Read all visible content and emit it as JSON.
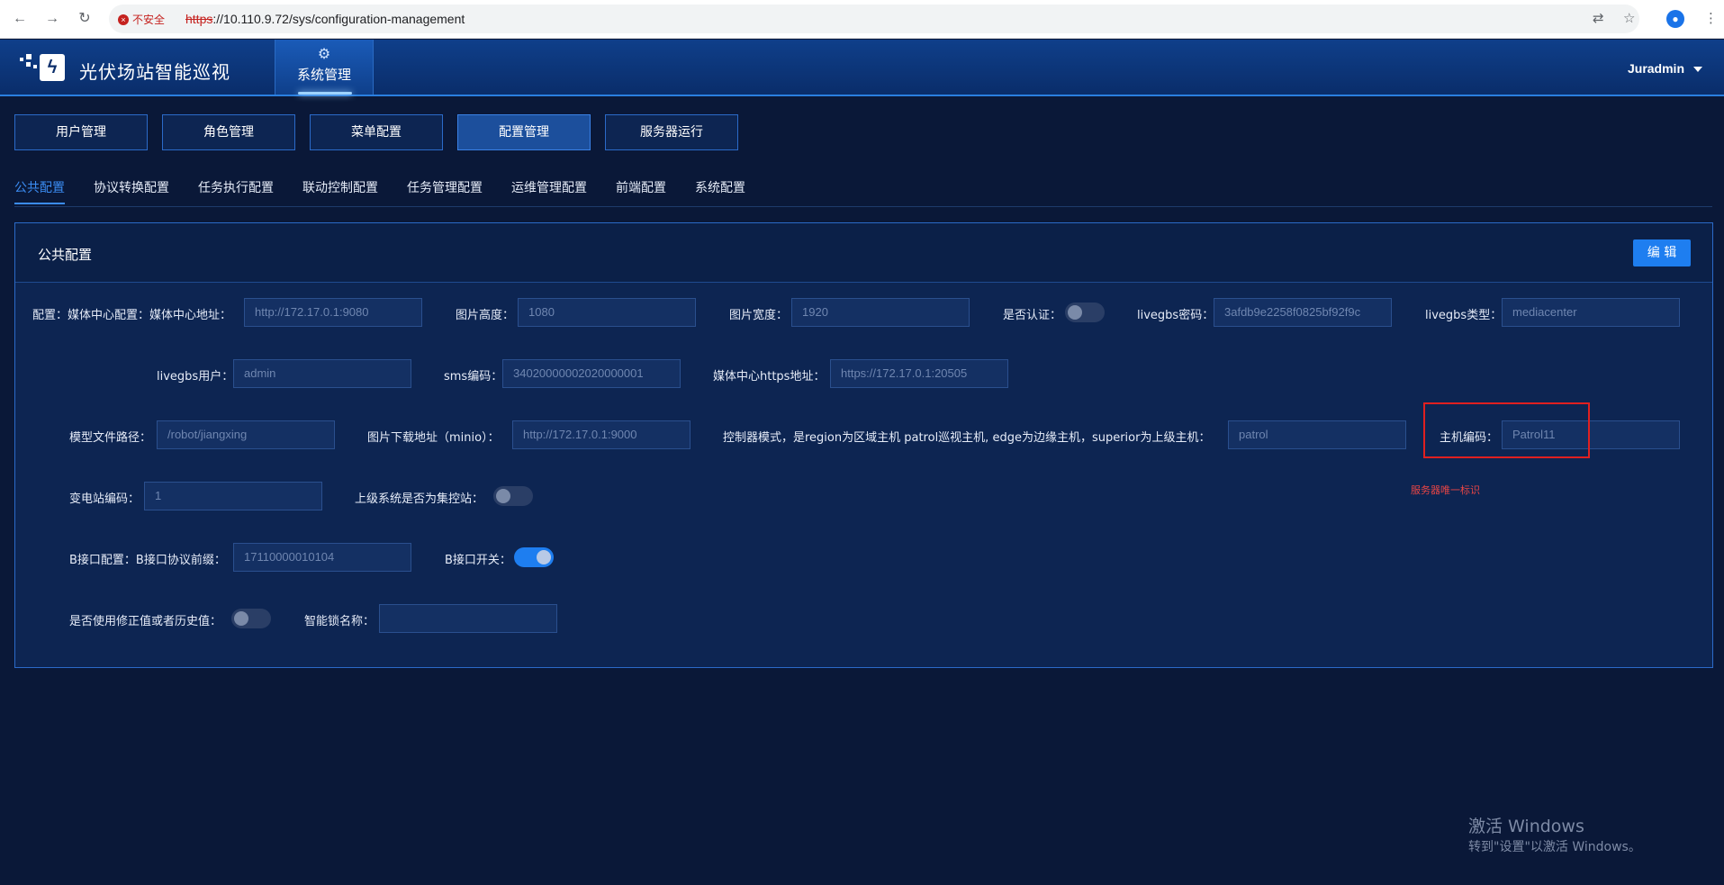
{
  "browser": {
    "insecure_label": "不安全",
    "url_scheme": "https",
    "url_rest": "://10.110.9.72/sys/configuration-management"
  },
  "header": {
    "app_title": "光伏场站智能巡视",
    "system_tab": "系统管理",
    "user": "Juradmin"
  },
  "top_buttons": [
    "用户管理",
    "角色管理",
    "菜单配置",
    "配置管理",
    "服务器运行"
  ],
  "sub_tabs": [
    "公共配置",
    "协议转换配置",
    "任务执行配置",
    "联动控制配置",
    "任务管理配置",
    "运维管理配置",
    "前端配置",
    "系统配置"
  ],
  "panel": {
    "title": "公共配置",
    "edit_label": "编 辑"
  },
  "fields": {
    "config_label": "配置：媒体中心配置：媒体中心地址：",
    "media_center_url": "http://172.17.0.1:9080",
    "image_height_label": "图片高度：",
    "image_height": "1080",
    "image_width_label": "图片宽度：",
    "image_width": "1920",
    "auth_label": "是否认证：",
    "livegbs_pwd_label": "livegbs密码：",
    "livegbs_pwd": "3afdb9e2258f0825bf92f9c",
    "livegbs_type_label": "livegbs类型：",
    "livegbs_type": "mediacenter",
    "livegbs_user_label": "livegbs用户：",
    "livegbs_user": "admin",
    "sms_code_label": "sms编码：",
    "sms_code": "34020000002020000001",
    "media_https_label": "媒体中心https地址：",
    "media_https": "https://172.17.0.1:20505",
    "model_path_label": "模型文件路径：",
    "model_path": "/robot/jiangxing",
    "image_download_label": "图片下载地址（minio）：",
    "image_download": "http://172.17.0.1:9000",
    "controller_mode_label": "控制器模式，是region为区域主机 patrol巡视主机, edge为边缘主机，superior为上级主机：",
    "controller_mode": "patrol",
    "host_code_label": "主机编码：",
    "host_code": "Patrol11",
    "host_code_hint": "服务器唯一标识",
    "substation_code_label": "变电站编码：",
    "substation_code": "1",
    "superior_central_label": "上级系统是否为集控站：",
    "b_interface_label": "B接口配置：B接口协议前缀：",
    "b_interface_prefix": "17110000010104",
    "b_switch_label": "B接口开关：",
    "use_corrected_label": "是否使用修正值或者历史值：",
    "smart_lock_label": "智能锁名称：",
    "smart_lock": ""
  },
  "toggles": {
    "auth": false,
    "superior_central": false,
    "b_switch": true,
    "use_corrected": false
  },
  "watermark": {
    "line1": "激活 Windows",
    "line2": "转到\"设置\"以激活 Windows。"
  }
}
